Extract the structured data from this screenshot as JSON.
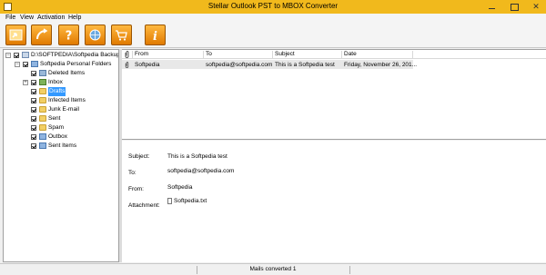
{
  "window": {
    "title": "Stellar Outlook PST to MBOX Converter"
  },
  "menu": [
    "File",
    "View",
    "Activation",
    "Help"
  ],
  "toolbar": [
    {
      "icon": "open-file-icon"
    },
    {
      "icon": "convert-icon"
    },
    {
      "icon": "help-icon"
    },
    {
      "icon": "register-icon"
    },
    {
      "icon": "buy-cart-icon"
    },
    {
      "icon": "info-icon"
    }
  ],
  "tree": {
    "root": "D:\\SOFTPEDIA\\Softpedia Backup.pst",
    "personal": "Softpedia Personal Folders",
    "folders": {
      "deleted": "Deleted Items",
      "inbox": "Inbox",
      "drafts": "Drafts",
      "infected": "Infected Items",
      "junk": "Junk E-mail",
      "sent": "Sent",
      "spam": "Spam",
      "outbox": "Outbox",
      "sent_items": "Sent Items"
    }
  },
  "list": {
    "headers": {
      "from": "From",
      "to": "To",
      "subject": "Subject",
      "date": "Date"
    },
    "rows": [
      {
        "from": "Softpedia",
        "to": "softpedia@softpedia.com",
        "subject": "This is a Softpedia test",
        "date": "Friday, November 26, 201..."
      }
    ]
  },
  "preview": {
    "subject_label": "Subject:",
    "subject": "This is a Softpedia test",
    "to_label": "To:",
    "to": "softpedia@softpedia.com",
    "from_label": "From:",
    "from": "Softpedia",
    "attachment_label": "Attachment:",
    "attachment": "Softpedia.txt"
  },
  "status": {
    "text": "Mails converted 1"
  },
  "colors": {
    "titlebar": "#f1b91c",
    "toolbar_button": "#e8900e",
    "selection": "#3399ff"
  }
}
